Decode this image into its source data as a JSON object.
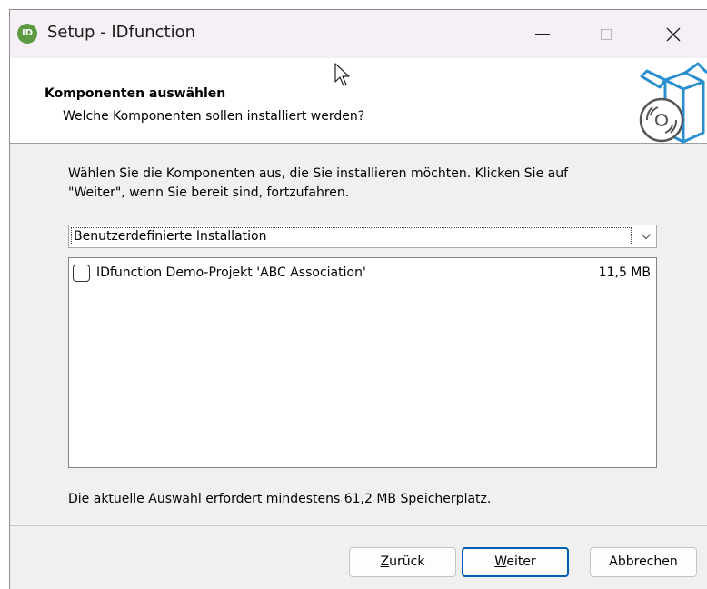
{
  "window": {
    "title": "Setup - IDfunction",
    "app_icon_text": "ID"
  },
  "header": {
    "title": "Komponenten auswählen",
    "subtitle": "Welche Komponenten sollen installiert werden?"
  },
  "body": {
    "instruction_line1": "Wählen Sie die Komponenten aus, die Sie installieren möchten. Klicken Sie auf",
    "instruction_line2": "\"Weiter\", wenn Sie bereit sind, fortzufahren.",
    "install_type": {
      "selected": "Benutzerdefinierte Installation"
    },
    "components": [
      {
        "label": "IDfunction Demo-Projekt 'ABC Association'",
        "size": "11,5 MB",
        "checked": false
      }
    ],
    "disk_space_text": "Die aktuelle Auswahl erfordert mindestens 61,2 MB Speicherplatz."
  },
  "buttons": {
    "back_accel": "Z",
    "back_rest": "urück",
    "next_accel": "W",
    "next_rest": "eiter",
    "cancel": "Abbrechen"
  },
  "colors": {
    "titlebar": "#f6eff5",
    "dialog_bg": "#f0f0f0",
    "default_button_border": "#005fb8",
    "app_icon": "#5d9a42"
  }
}
